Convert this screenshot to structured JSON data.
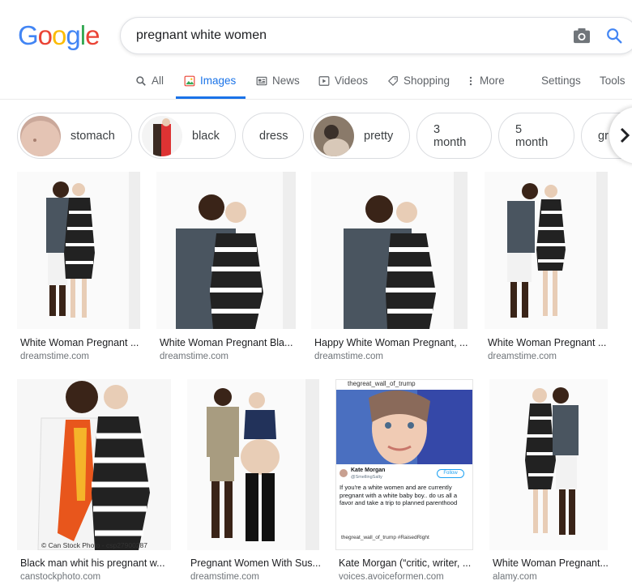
{
  "logo": {
    "letters": [
      "G",
      "o",
      "o",
      "g",
      "l",
      "e"
    ],
    "colors": [
      "#4285f4",
      "#ea4335",
      "#fbbc05",
      "#4285f4",
      "#34a853",
      "#ea4335"
    ]
  },
  "search": {
    "query": "pregnant white women"
  },
  "tabs": [
    {
      "label": "All",
      "icon": "search-icon"
    },
    {
      "label": "Images",
      "icon": "image-icon"
    },
    {
      "label": "News",
      "icon": "news-icon"
    },
    {
      "label": "Videos",
      "icon": "video-icon"
    },
    {
      "label": "Shopping",
      "icon": "tag-icon"
    },
    {
      "label": "More",
      "icon": "more-vertical-icon"
    },
    {
      "label": "Settings"
    },
    {
      "label": "Tools"
    }
  ],
  "chips": [
    {
      "label": "stomach"
    },
    {
      "label": "black"
    },
    {
      "label": "dress"
    },
    {
      "label": "pretty"
    },
    {
      "label": "3 month"
    },
    {
      "label": "5 month"
    },
    {
      "label": "gr"
    }
  ],
  "results": [
    {
      "title": "White Woman Pregnant ...",
      "source": "dreamstime.com"
    },
    {
      "title": "White Woman Pregnant Bla...",
      "source": "dreamstime.com"
    },
    {
      "title": "Happy White Woman Pregnant, ...",
      "source": "dreamstime.com"
    },
    {
      "title": "White Woman Pregnant ...",
      "source": "dreamstime.com"
    },
    {
      "title": "Black man whit his pregnant w...",
      "source": "canstockphoto.com"
    },
    {
      "title": "Pregnant Women With Sus...",
      "source": "dreamstime.com"
    },
    {
      "title": "Kate Morgan (“critic, writer, ...",
      "source": "voices.avoiceformen.com"
    },
    {
      "title": "White Woman Pregnant...",
      "source": "alamy.com"
    }
  ],
  "tweet": {
    "header": "thegreat_wall_of_trump",
    "name": "Kate Morgan",
    "handle": "@SmellingSalty",
    "follow": "Follow",
    "text": "If you're a white women and are currently pregnant with a white baby boy.. do us all a favor and take a trip to planned parenthood",
    "footer": "thegreat_wall_of_trump #RaisedRight"
  },
  "watermark": {
    "canstock": "© Can Stock Photo - csp27900287"
  },
  "colors": {
    "accent": "#1a73e8",
    "muted": "#5f6368",
    "border": "#dadce0"
  }
}
